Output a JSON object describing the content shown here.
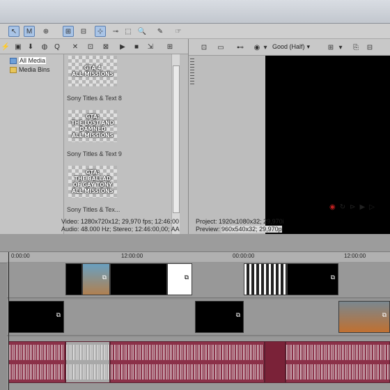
{
  "preview": {
    "quality": "Good (Half)",
    "info": {
      "project_label": "Project:",
      "project_value": "1920x1080x32; 29,970i",
      "preview_label": "Preview:",
      "preview_value": "960x540x32; 29,970p"
    }
  },
  "explorer": {
    "tree": [
      "All Media",
      "Media Bins"
    ],
    "thumbnails": [
      {
        "text": "GTA 4\nALL MISSIONS",
        "caption": "Sony Titles & Text 8"
      },
      {
        "text": "GTA:\nTHE LOST AND\nDAMNED\nALL MISSIONS",
        "caption": "Sony Titles & Text 9"
      },
      {
        "text": "GTA:\nTHE BALLAD\nOF GAY TONY\nALL MISSIONS",
        "caption": "Sony Titles & Tex..."
      }
    ],
    "media_info": {
      "video": "Video: 1280x720x12; 29,970 fps; 12:46:00",
      "audio": "Audio: 48.000 Hz; Stereo; 12:46:00,00; AA"
    }
  },
  "timeline": {
    "ruler_labels": [
      "0:00:00",
      "12:00:00",
      "00:00:00",
      "12:00:00"
    ]
  },
  "colors": {
    "audio_clip": "#8b3048",
    "selection": "#a9c4e6",
    "record": "#c02020"
  }
}
